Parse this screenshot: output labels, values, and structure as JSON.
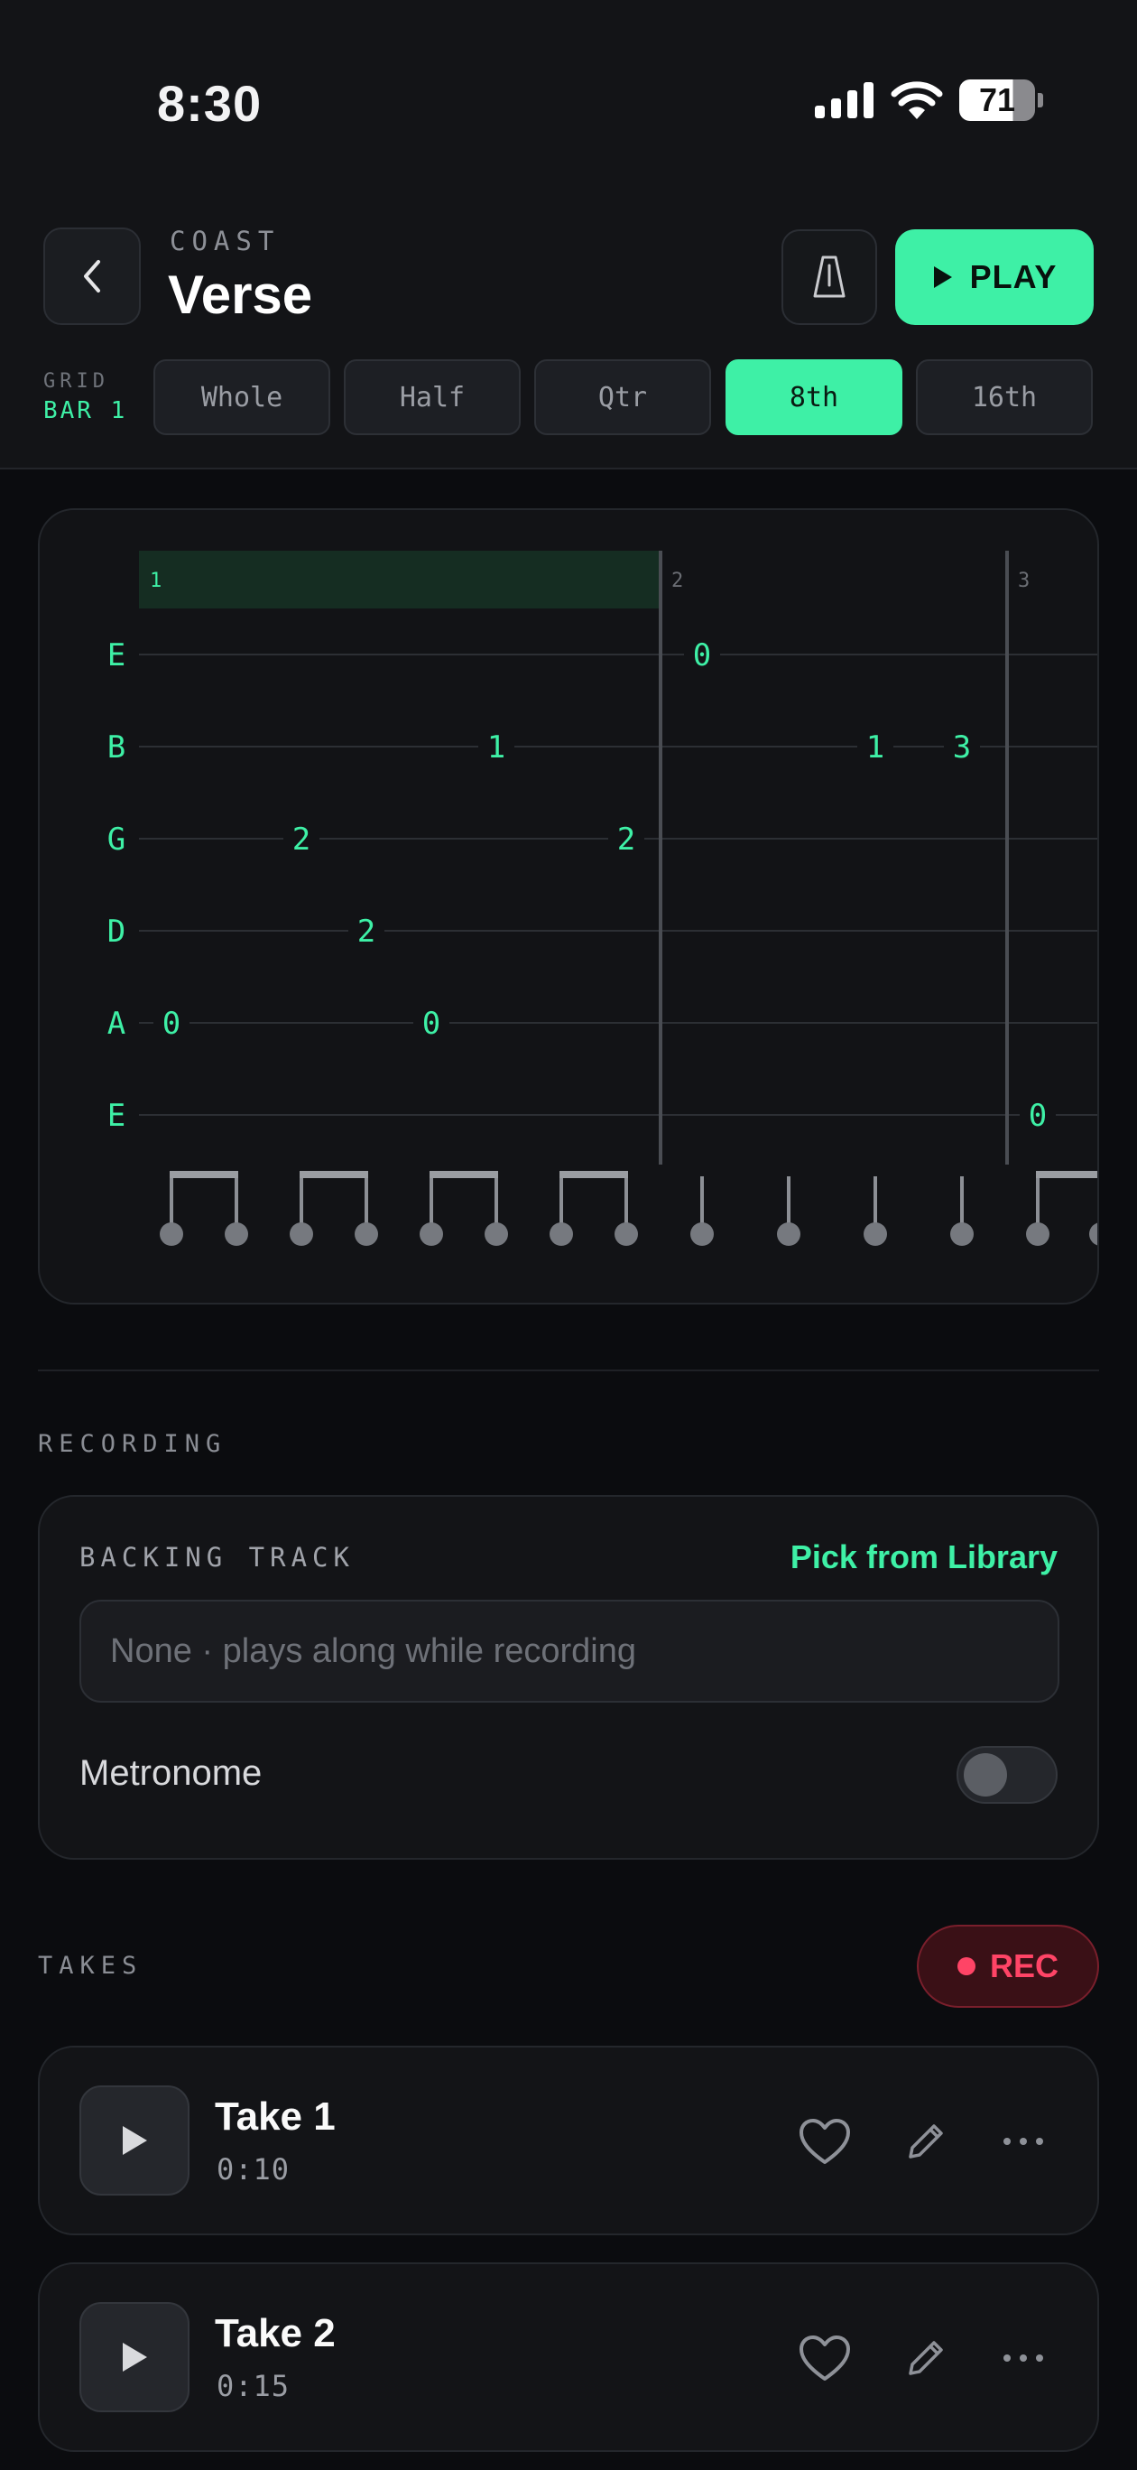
{
  "status_bar": {
    "time": "8:30",
    "battery": "71"
  },
  "header": {
    "eyebrow": "COAST",
    "title": "Verse",
    "play_label": "PLAY"
  },
  "grid": {
    "label": "GRID",
    "bar": "BAR 1",
    "options": [
      "Whole",
      "Half",
      "Qtr",
      "8th",
      "16th"
    ],
    "selected": "8th"
  },
  "tab": {
    "strings": [
      "E",
      "B",
      "G",
      "D",
      "A",
      "E"
    ],
    "bar_numbers": [
      "1",
      "2",
      "3"
    ],
    "notes": [
      {
        "string": 4,
        "fret": "0",
        "step": 0
      },
      {
        "string": 2,
        "fret": "2",
        "step": 2
      },
      {
        "string": 3,
        "fret": "2",
        "step": 3
      },
      {
        "string": 4,
        "fret": "0",
        "step": 4
      },
      {
        "string": 1,
        "fret": "1",
        "step": 5
      },
      {
        "string": 2,
        "fret": "2",
        "step": 7
      },
      {
        "string": 0,
        "fret": "0",
        "step": 8
      },
      {
        "string": 1,
        "fret": "1",
        "step": 10
      },
      {
        "string": 1,
        "fret": "3",
        "step": 11
      },
      {
        "string": 5,
        "fret": "0",
        "step": 12
      }
    ]
  },
  "recording": {
    "section_label": "RECORDING",
    "backing_label": "BACKING TRACK",
    "pick_label": "Pick from Library",
    "backing_placeholder": "None · plays along while recording",
    "metronome_label": "Metronome",
    "metronome_on": false
  },
  "takes": {
    "section_label": "TAKES",
    "rec_label": "REC",
    "items": [
      {
        "name": "Take 1",
        "duration": "0:10"
      },
      {
        "name": "Take 2",
        "duration": "0:15"
      }
    ]
  },
  "colors": {
    "accent": "#3ef0a6",
    "rec": "#ff4466",
    "background": "#0b0c0f"
  },
  "icons": {
    "back": "chevron-left-icon",
    "metronome": "metronome-icon",
    "play": "play-icon",
    "favorite": "heart-icon",
    "edit": "pencil-icon",
    "more": "ellipsis-icon"
  }
}
